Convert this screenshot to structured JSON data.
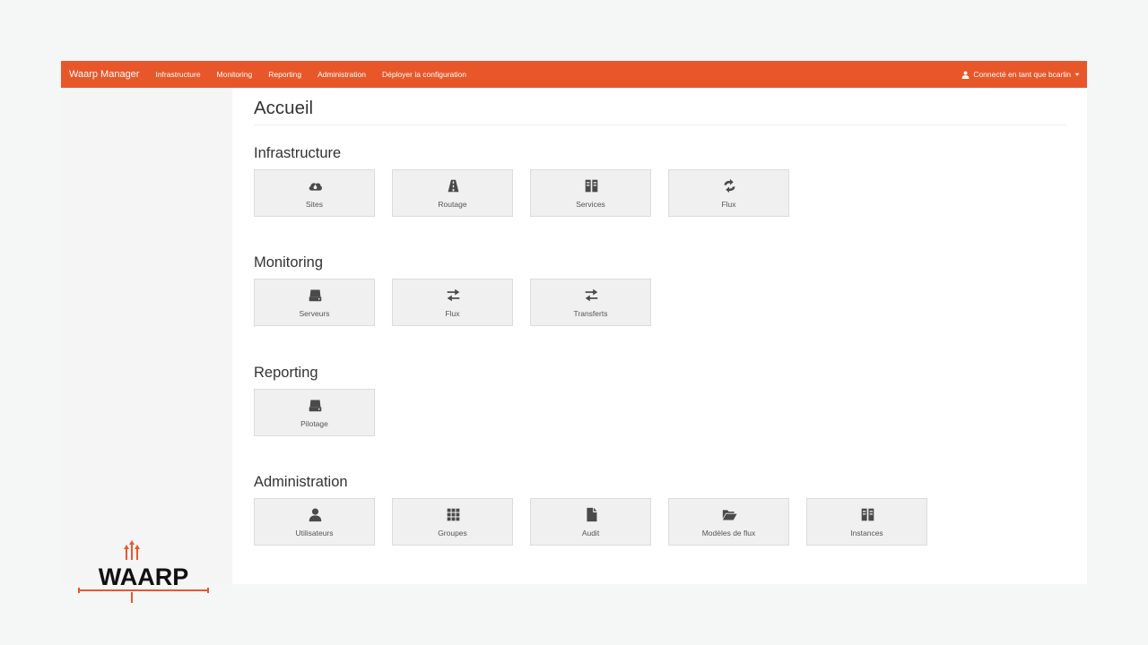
{
  "navbar": {
    "brand": "Waarp Manager",
    "items": [
      {
        "label": "Infrastructure"
      },
      {
        "label": "Monitoring"
      },
      {
        "label": "Reporting"
      },
      {
        "label": "Administration"
      },
      {
        "label": "Déployer la configuration"
      }
    ],
    "user_label": "Connecté en tant que bcarlin",
    "user_icon": "user-icon",
    "color": "#e8572a"
  },
  "page": {
    "title": "Accueil",
    "background": "#f5f6f6"
  },
  "logo": {
    "text": "WAARP",
    "accent": "#e8572a"
  },
  "sections": [
    {
      "title": "Infrastructure",
      "tiles": [
        {
          "label": "Sites",
          "icon": "cloud-icon"
        },
        {
          "label": "Routage",
          "icon": "road-icon"
        },
        {
          "label": "Services",
          "icon": "book-icon"
        },
        {
          "label": "Flux",
          "icon": "refresh-icon"
        }
      ]
    },
    {
      "title": "Monitoring",
      "tiles": [
        {
          "label": "Serveurs",
          "icon": "hdd-icon"
        },
        {
          "label": "Flux",
          "icon": "transfer-icon"
        },
        {
          "label": "Transferts",
          "icon": "transfer-icon"
        }
      ]
    },
    {
      "title": "Reporting",
      "tiles": [
        {
          "label": "Pilotage",
          "icon": "hdd-icon"
        }
      ]
    },
    {
      "title": "Administration",
      "tiles": [
        {
          "label": "Utilisateurs",
          "icon": "user-icon"
        },
        {
          "label": "Groupes",
          "icon": "th-icon"
        },
        {
          "label": "Audit",
          "icon": "file-icon"
        },
        {
          "label": "Modèles de flux",
          "icon": "folder-open-icon"
        },
        {
          "label": "Instances",
          "icon": "book-icon"
        }
      ]
    }
  ]
}
